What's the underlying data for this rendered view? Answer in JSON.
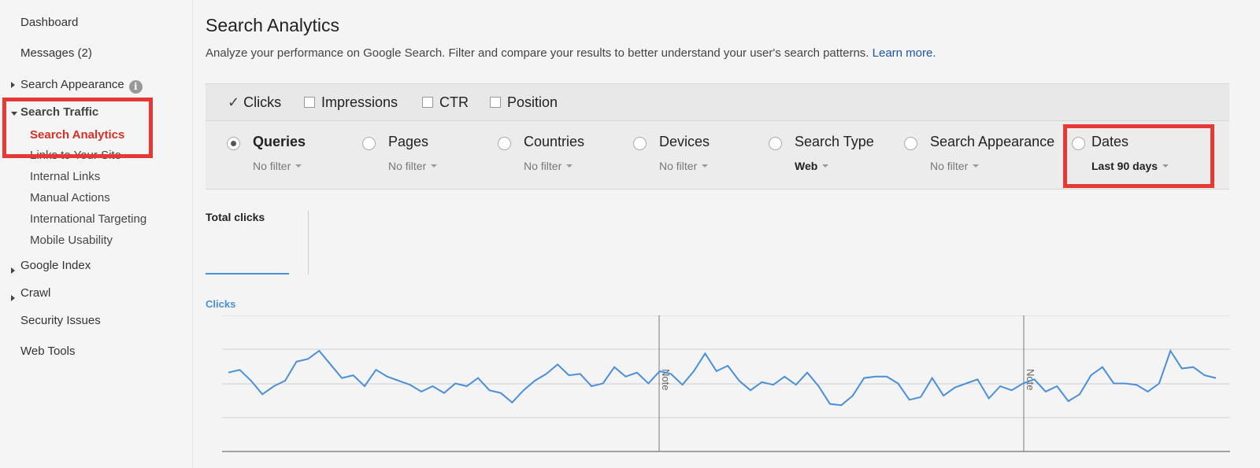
{
  "sidebar": {
    "items": [
      {
        "label": "Dashboard"
      },
      {
        "label": "Messages (2)"
      },
      {
        "label": "Search Appearance",
        "info_icon": "i"
      },
      {
        "label": "Search Traffic"
      },
      {
        "label": "Google Index"
      },
      {
        "label": "Crawl"
      },
      {
        "label": "Security Issues"
      },
      {
        "label": "Web Tools"
      }
    ],
    "sub_items": [
      {
        "label": "Search Analytics"
      },
      {
        "label": "Links to Your Site"
      },
      {
        "label": "Internal Links"
      },
      {
        "label": "Manual Actions"
      },
      {
        "label": "International Targeting"
      },
      {
        "label": "Mobile Usability"
      }
    ],
    "active_color": "#d93025"
  },
  "header": {
    "title": "Search Analytics",
    "description": "Analyze your performance on Google Search. Filter and compare your results to better understand your user's search patterns.",
    "learn_more": "Learn more."
  },
  "metrics": [
    {
      "label": "Clicks",
      "checked": true
    },
    {
      "label": "Impressions",
      "checked": false
    },
    {
      "label": "CTR",
      "checked": false
    },
    {
      "label": "Position",
      "checked": false
    }
  ],
  "dimensions": [
    {
      "label": "Queries",
      "filter": "No filter",
      "selected": true
    },
    {
      "label": "Pages",
      "filter": "No filter",
      "selected": false
    },
    {
      "label": "Countries",
      "filter": "No filter",
      "selected": false
    },
    {
      "label": "Devices",
      "filter": "No filter",
      "selected": false
    },
    {
      "label": "Search Type",
      "filter": "Web",
      "selected": false
    },
    {
      "label": "Search Appearance",
      "filter": "No filter",
      "selected": false
    },
    {
      "label": "Dates",
      "filter": "Last 90 days",
      "selected": false
    }
  ],
  "totals": {
    "label": "Total clicks"
  },
  "chart_data": {
    "type": "line",
    "title": "Clicks",
    "series": [
      {
        "color": "#4a8fd9",
        "values": [
          0.58,
          0.6,
          0.52,
          0.42,
          0.48,
          0.52,
          0.66,
          0.68,
          0.74,
          0.64,
          0.54,
          0.56,
          0.48,
          0.6,
          0.55,
          0.52,
          0.49,
          0.44,
          0.48,
          0.43,
          0.5,
          0.48,
          0.54,
          0.45,
          0.43,
          0.36,
          0.45,
          0.52,
          0.57,
          0.64,
          0.56,
          0.57,
          0.48,
          0.5,
          0.62,
          0.55,
          0.58,
          0.5,
          0.59,
          0.57,
          0.49,
          0.59,
          0.72,
          0.59,
          0.63,
          0.52,
          0.45,
          0.51,
          0.49,
          0.55,
          0.49,
          0.58,
          0.48,
          0.35,
          0.34,
          0.41,
          0.54,
          0.55,
          0.55,
          0.5,
          0.38,
          0.4,
          0.54,
          0.41,
          0.47,
          0.5,
          0.53,
          0.39,
          0.48,
          0.45,
          0.5,
          0.53,
          0.44,
          0.48,
          0.37,
          0.42,
          0.56,
          0.62,
          0.5,
          0.5,
          0.49,
          0.44,
          0.5,
          0.74,
          0.61,
          0.62,
          0.56,
          0.54
        ]
      }
    ],
    "notes": [
      "Note",
      "Note"
    ],
    "grid": true
  }
}
